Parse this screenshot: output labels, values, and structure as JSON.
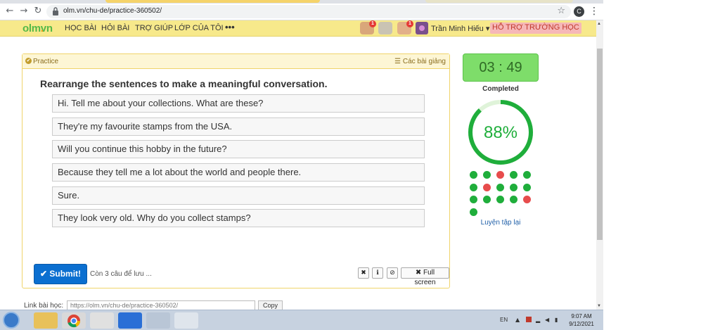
{
  "browser": {
    "url": "olm.vn/chu-de/practice-360502/",
    "profile_initial": "C"
  },
  "site": {
    "logo_main": "olm",
    "logo_dot": ".",
    "logo_tld": "vn",
    "menu": [
      "HỌC BÀI",
      "HỎI BÀI",
      "TRỢ GIÚP",
      "LỚP CỦA TÔI"
    ],
    "more": "•••",
    "notification_badges": [
      "1",
      "1"
    ],
    "username": "Trần Minh Hiếu ▾",
    "support_label": "HỖ TRỢ TRƯỜNG HỌC"
  },
  "panel": {
    "title": "Practice",
    "lessons_label": "Các bài giảng",
    "question": "Rearrange the sentences to make a meaningful conversation.",
    "sentences": [
      "Hi. Tell me about your collections. What are these?",
      "They're my favourite stamps from the USA.",
      "Will you continue this hobby in the future?",
      "Because they tell me a lot about the world and people there.",
      "Sure.",
      "They look very old. Why do you collect stamps?"
    ],
    "submit_label": "✔ Submit!",
    "remaining_label": "Còn 3 câu để lưu ...",
    "fullscreen_label": "✖ Full screen"
  },
  "progress": {
    "timer": "03 : 49",
    "completed_label": "Completed",
    "percent_label": "88%",
    "percent_value": 0.88,
    "results": [
      "correct",
      "correct",
      "wrong",
      "correct",
      "correct",
      "correct",
      "wrong",
      "correct",
      "correct",
      "correct",
      "correct",
      "correct",
      "correct",
      "correct",
      "wrong",
      "correct"
    ],
    "redo_label": "Luyện tập lại",
    "colors": {
      "correct": "#1fae3b",
      "wrong": "#e74c4c",
      "track": "#dff3d9"
    }
  },
  "footer": {
    "link_label": "Link bài học:",
    "link_value": "https://olm.vn/chu-de/practice-360502/",
    "copy_label": "Copy"
  },
  "taskbar": {
    "lang": "EN",
    "time": "9:07 AM",
    "date": "9/12/2021"
  }
}
